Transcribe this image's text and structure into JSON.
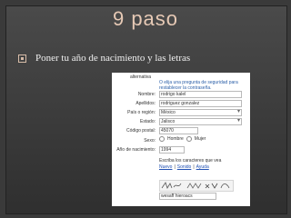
{
  "slide": {
    "title": "9 paso",
    "bullet": "Poner tu año de nacimiento y las letras"
  },
  "form": {
    "alt_top": "alternativa",
    "note_line1": "O elija una pregunta de seguridad para",
    "note_line2": "restablecer la contraseña.",
    "fields": [
      {
        "label": "Nombre:",
        "value": "rodrigo kalel",
        "type": "text"
      },
      {
        "label": "Apellidos:",
        "value": "rodriguez gonzalez",
        "type": "text"
      },
      {
        "label": "País o región:",
        "value": "México",
        "type": "select"
      },
      {
        "label": "Estado:",
        "value": "Jalisco",
        "type": "select"
      },
      {
        "label": "Código postal:",
        "value": "45070",
        "type": "text"
      },
      {
        "label": "Sexo:",
        "value": "",
        "type": "radio"
      },
      {
        "label": "Año de nacimiento:",
        "value": "1994",
        "type": "text"
      }
    ],
    "sex_options": [
      "Hombre",
      "Mujer"
    ],
    "captcha_prompt": "Escriba los caracteres que vea",
    "captcha_links": [
      "Nuevo",
      "Sonido",
      "Ayuda"
    ],
    "captcha_answer": "wesaff hieroacs",
    "accent_color": "#2b5fa8"
  }
}
